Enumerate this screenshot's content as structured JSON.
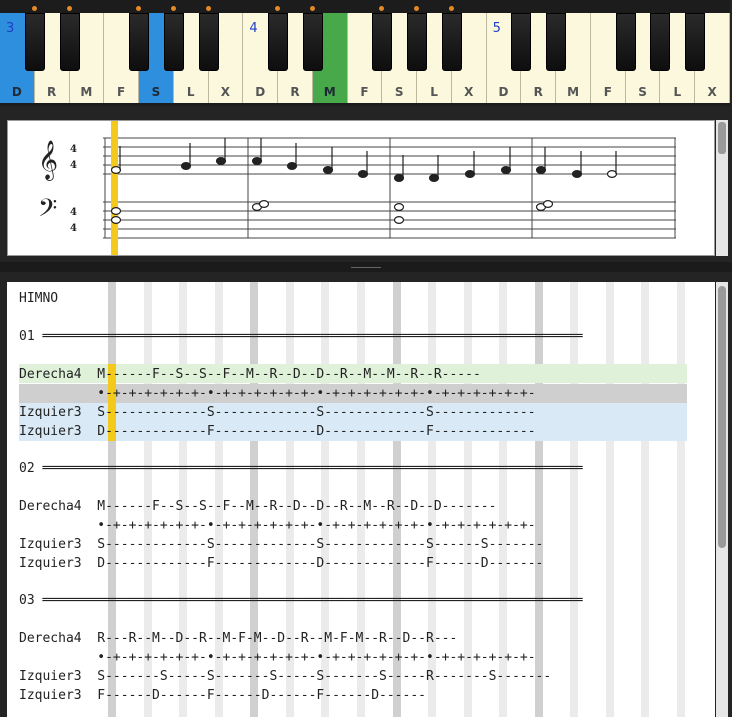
{
  "keyboard": {
    "white_keys": [
      {
        "label": "D",
        "octave": "3",
        "highlight": "blue"
      },
      {
        "label": "R"
      },
      {
        "label": "M"
      },
      {
        "label": "F"
      },
      {
        "label": "S",
        "highlight": "blue"
      },
      {
        "label": "L"
      },
      {
        "label": "X"
      },
      {
        "label": "D",
        "octave": "4"
      },
      {
        "label": "R"
      },
      {
        "label": "M",
        "highlight": "green"
      },
      {
        "label": "F"
      },
      {
        "label": "S"
      },
      {
        "label": "L"
      },
      {
        "label": "X"
      },
      {
        "label": "D",
        "octave": "5"
      },
      {
        "label": "R"
      },
      {
        "label": "M"
      },
      {
        "label": "F"
      },
      {
        "label": "S"
      },
      {
        "label": "L"
      },
      {
        "label": "X"
      }
    ],
    "colors": {
      "blue": "#2f8fdf",
      "green": "#47a949",
      "dot": "#e48a25"
    }
  },
  "staff": {
    "treble_time": [
      "4",
      "4"
    ],
    "bass_time": [
      "4",
      "4"
    ],
    "clef_treble_icon": "treble-clef-icon",
    "clef_bass_icon": "bass-clef-icon"
  },
  "tab": {
    "title": "HIMNO",
    "lines": [
      "01 ═════════════════════════════════════════════════════════════════════",
      "Derecha4  M------F--S--S--F--M--R--D--D--R--M--M--R--R-----",
      "          •-+-+-+-+-+-+-•-+-+-+-+-+-+-•-+-+-+-+-+-+-•-+-+-+-+-+-+-",
      "Izquier3  S-------------S-------------S-------------S-------------",
      "Izquier3  D-------------F-------------D-------------F-------------",
      "02 ═════════════════════════════════════════════════════════════════════",
      "Derecha4  M------F--S--S--F--M--R--D--D--R--M--R--D--D-------",
      "          •-+-+-+-+-+-+-•-+-+-+-+-+-+-•-+-+-+-+-+-+-•-+-+-+-+-+-+-",
      "Izquier3  S-------------S-------------S-------------S------S-------",
      "Izquier3  D-------------F-------------D-------------F------D-------",
      "03 ═════════════════════════════════════════════════════════════════════",
      "Derecha4  R---R--M--D--R--M-F-M--D--R--M-F-M--R--D--R---",
      "          •-+-+-+-+-+-+-•-+-+-+-+-+-+-•-+-+-+-+-+-+-•-+-+-+-+-+-+-",
      "Izquier3  S-------S-----S-------S-----S-------S-----R-------S-------",
      "Izquier3  F------D------F------D------F------D------"
    ]
  }
}
